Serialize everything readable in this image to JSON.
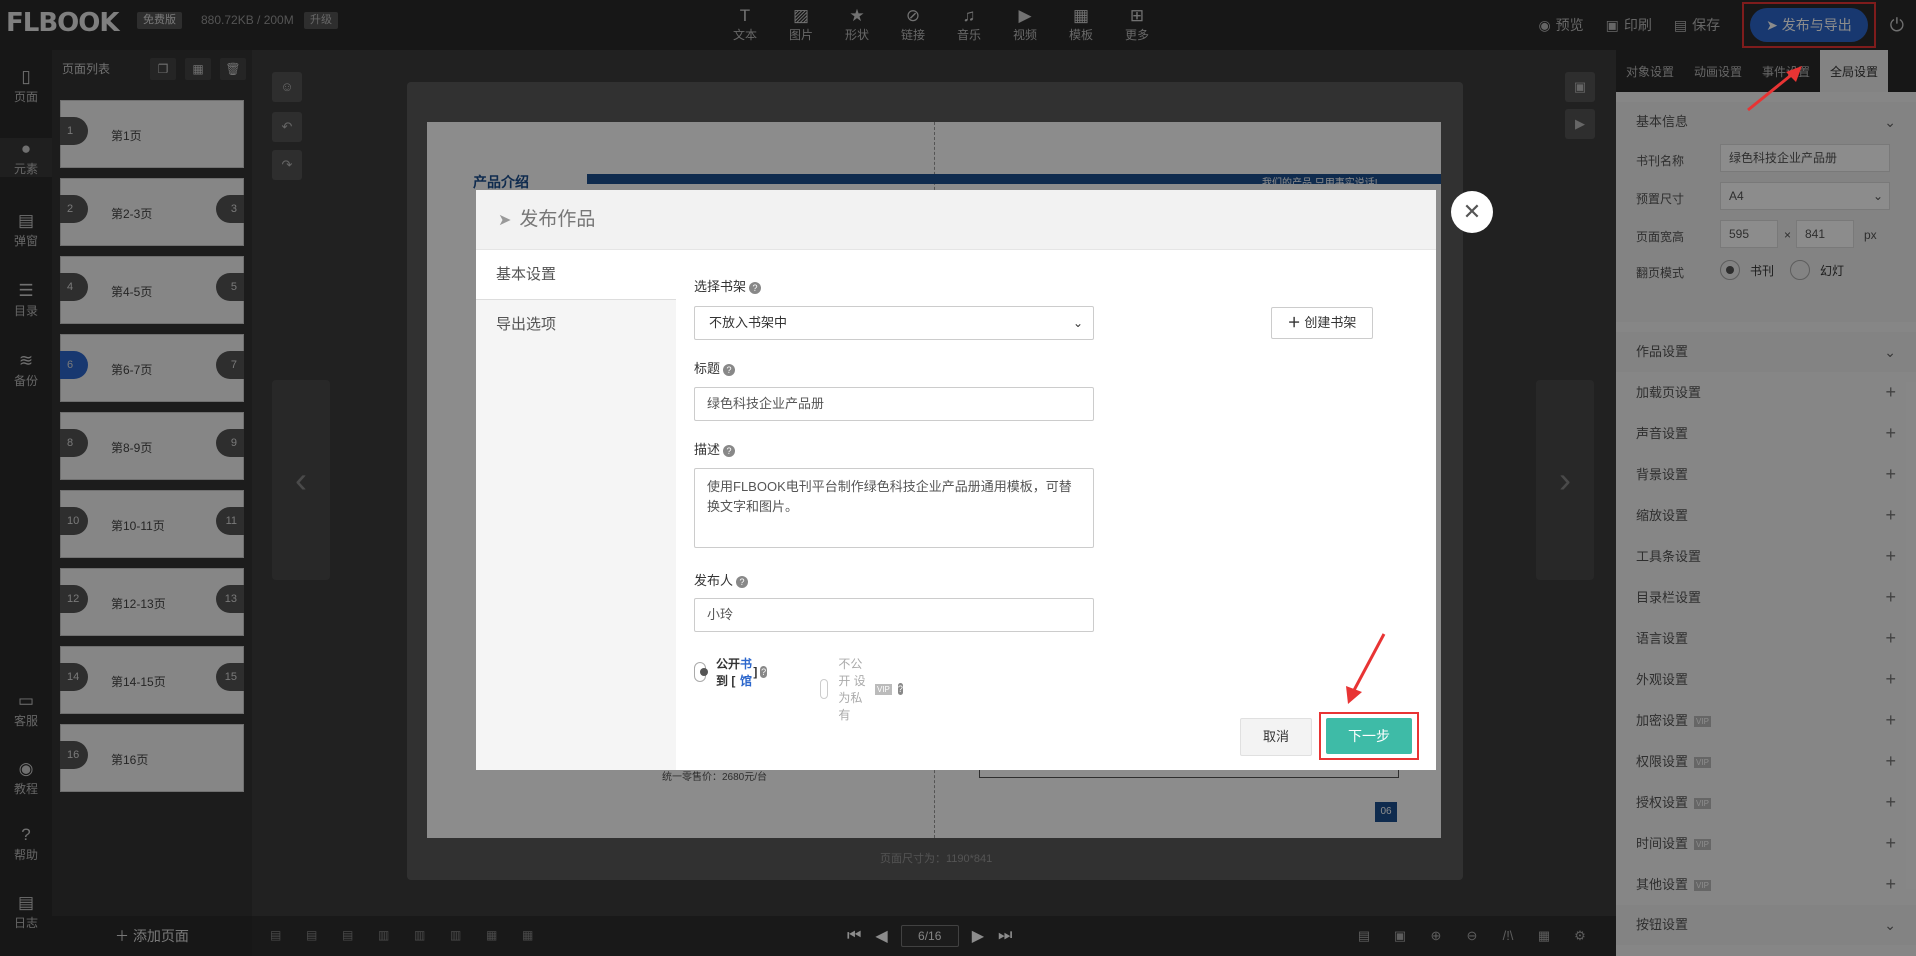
{
  "app": {
    "logo": "FLBOOK",
    "edition_badge": "免费版",
    "storage": "880.72KB / 200M",
    "upgrade": "升级"
  },
  "toolbar": [
    {
      "label": "文本",
      "icon": "text-icon"
    },
    {
      "label": "图片",
      "icon": "image-icon"
    },
    {
      "label": "形状",
      "icon": "star-icon"
    },
    {
      "label": "链接",
      "icon": "link-icon"
    },
    {
      "label": "音乐",
      "icon": "music-icon"
    },
    {
      "label": "视频",
      "icon": "video-icon"
    },
    {
      "label": "模板",
      "icon": "template-icon"
    },
    {
      "label": "更多",
      "icon": "more-icon"
    }
  ],
  "header_actions": {
    "preview": "预览",
    "print": "印刷",
    "save": "保存",
    "publish": "发布与导出"
  },
  "leftnav": [
    {
      "label": "页面",
      "icon": "page-icon"
    },
    {
      "label": "元素",
      "icon": "element-icon"
    },
    {
      "label": "弹窗",
      "icon": "popup-icon"
    },
    {
      "label": "目录",
      "icon": "toc-icon"
    },
    {
      "label": "备份",
      "icon": "backup-icon"
    },
    {
      "label": "客服",
      "icon": "chat-icon"
    },
    {
      "label": "教程",
      "icon": "tutorial-icon"
    },
    {
      "label": "帮助",
      "icon": "help-icon"
    },
    {
      "label": "日志",
      "icon": "log-icon"
    }
  ],
  "pagelist": {
    "title": "页面列表",
    "pages": [
      {
        "n": "1",
        "n2": "",
        "label": "第1页"
      },
      {
        "n": "2",
        "n2": "3",
        "label": "第2-3页"
      },
      {
        "n": "4",
        "n2": "5",
        "label": "第4-5页"
      },
      {
        "n": "6",
        "n2": "7",
        "label": "第6-7页"
      },
      {
        "n": "8",
        "n2": "9",
        "label": "第8-9页"
      },
      {
        "n": "10",
        "n2": "11",
        "label": "第10-11页"
      },
      {
        "n": "12",
        "n2": "13",
        "label": "第12-13页"
      },
      {
        "n": "14",
        "n2": "15",
        "label": "第14-15页"
      },
      {
        "n": "16",
        "n2": "",
        "label": "第16页"
      }
    ],
    "add_page": "添加页面"
  },
  "canvas": {
    "page_size": "页面尺寸为：1190*841",
    "page_indicator": "6/16",
    "page_heading": "产品介绍",
    "slogan": "我们的产品  只用事实说话!",
    "price_note": "统一零售价：2680元/台",
    "page_num": "06"
  },
  "modal": {
    "title": "发布作品",
    "tabs": [
      "基本设置",
      "导出选项"
    ],
    "shelf_label": "选择书架",
    "shelf_value": "不放入书架中",
    "create_shelf": "创建书架",
    "title_label": "标题",
    "title_value": "绿色科技企业产品册",
    "desc_label": "描述",
    "desc_value": "使用FLBOOK电刊平台制作绿色科技企业产品册通用模板，可替换文字和图片。",
    "publisher_label": "发布人",
    "publisher_value": "小玲",
    "public_pre": "公开到 [",
    "public_link": "书馆",
    "public_post": "]",
    "private_label": "不公开 设为私有",
    "vip": "VIP",
    "cancel": "取消",
    "next": "下一步"
  },
  "rightpanel": {
    "tabs": [
      "对象设置",
      "动画设置",
      "事件设置",
      "全局设置"
    ],
    "basic_info": "基本信息",
    "book_name_label": "书刊名称",
    "book_name": "绿色科技企业产品册",
    "preset_label": "预置尺寸",
    "preset": "A4",
    "wh_label": "页面宽高",
    "width": "595",
    "height": "841",
    "times": "×",
    "unit": "px",
    "flip_label": "翻页模式",
    "flip_book": "书刊",
    "flip_slide": "幻灯",
    "work_settings": "作品设置",
    "items": [
      {
        "label": "加载页设置",
        "vip": false
      },
      {
        "label": "声音设置",
        "vip": false
      },
      {
        "label": "背景设置",
        "vip": false
      },
      {
        "label": "缩放设置",
        "vip": false
      },
      {
        "label": "工具条设置",
        "vip": false
      },
      {
        "label": "目录栏设置",
        "vip": false
      },
      {
        "label": "语言设置",
        "vip": false
      },
      {
        "label": "外观设置",
        "vip": false
      },
      {
        "label": "加密设置",
        "vip": true
      },
      {
        "label": "权限设置",
        "vip": true
      },
      {
        "label": "授权设置",
        "vip": true
      },
      {
        "label": "时间设置",
        "vip": true
      },
      {
        "label": "其他设置",
        "vip": true
      }
    ],
    "button_settings": "按钮设置"
  },
  "colors": {
    "accent": "#2c67cc",
    "next": "#3ebba7",
    "highlight": "#e83434"
  }
}
